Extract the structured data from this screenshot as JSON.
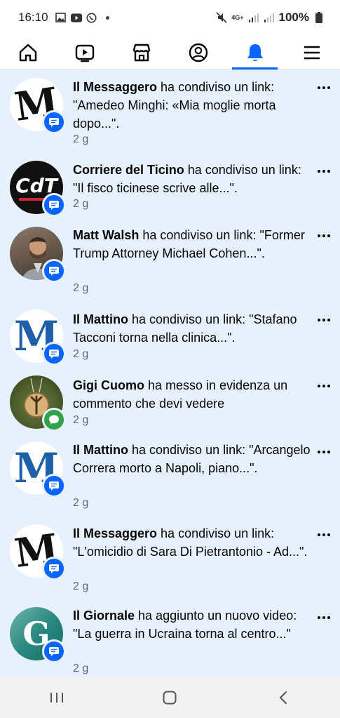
{
  "status_bar": {
    "time": "16:10",
    "battery": "100%",
    "network": "4G+"
  },
  "nav": {
    "items": [
      {
        "icon": "home-icon"
      },
      {
        "icon": "video-icon"
      },
      {
        "icon": "marketplace-icon"
      },
      {
        "icon": "profile-icon"
      },
      {
        "icon": "notifications-bell-icon",
        "active": true
      },
      {
        "icon": "menu-icon"
      }
    ],
    "active_color": "#0866ff"
  },
  "notifications": [
    {
      "name": "Il Messaggero",
      "action": " ha condiviso un link: \"Amedeo Minghi: «Mia moglie morta dopo...\".",
      "time": "2 g",
      "badge": "comment"
    },
    {
      "name": "Corriere del Ticino",
      "action": " ha condiviso un link: \"Il fisco ticinese scrive alle...\".",
      "time": "2 g",
      "badge": "comment"
    },
    {
      "name": "Matt Walsh",
      "action": " ha condiviso un link: \"Former Trump Attorney Michael Cohen...\".",
      "time": "2 g",
      "badge": "comment"
    },
    {
      "name": "Il Mattino",
      "action": " ha condiviso un link: \"Stafano Tacconi torna nella clinica...\".",
      "time": "2 g",
      "badge": "comment"
    },
    {
      "name": "Gigi Cuomo",
      "action": " ha messo in evidenza un commento che devi vedere",
      "time": "2 g",
      "badge": "speech"
    },
    {
      "name": "Il Mattino",
      "action": " ha condiviso un link: \"Arcangelo Correra morto a Napoli, piano...\".",
      "time": "2 g",
      "badge": "comment"
    },
    {
      "name": "Il Messaggero",
      "action": " ha condiviso un link: \"L'omicidio di Sara Di Pietrantonio - Ad...\".",
      "time": "2 g",
      "badge": "comment"
    },
    {
      "name": "Il Giornale",
      "action": " ha aggiunto un nuovo video: \"La guerra in Ucraina torna al centro...\"",
      "time": "2 g",
      "badge": "comment"
    }
  ],
  "avatars": {
    "messaggero_logo": "M",
    "cdt_logo": "CdT",
    "mattino_logo": "M",
    "giornale_logo": "G"
  }
}
